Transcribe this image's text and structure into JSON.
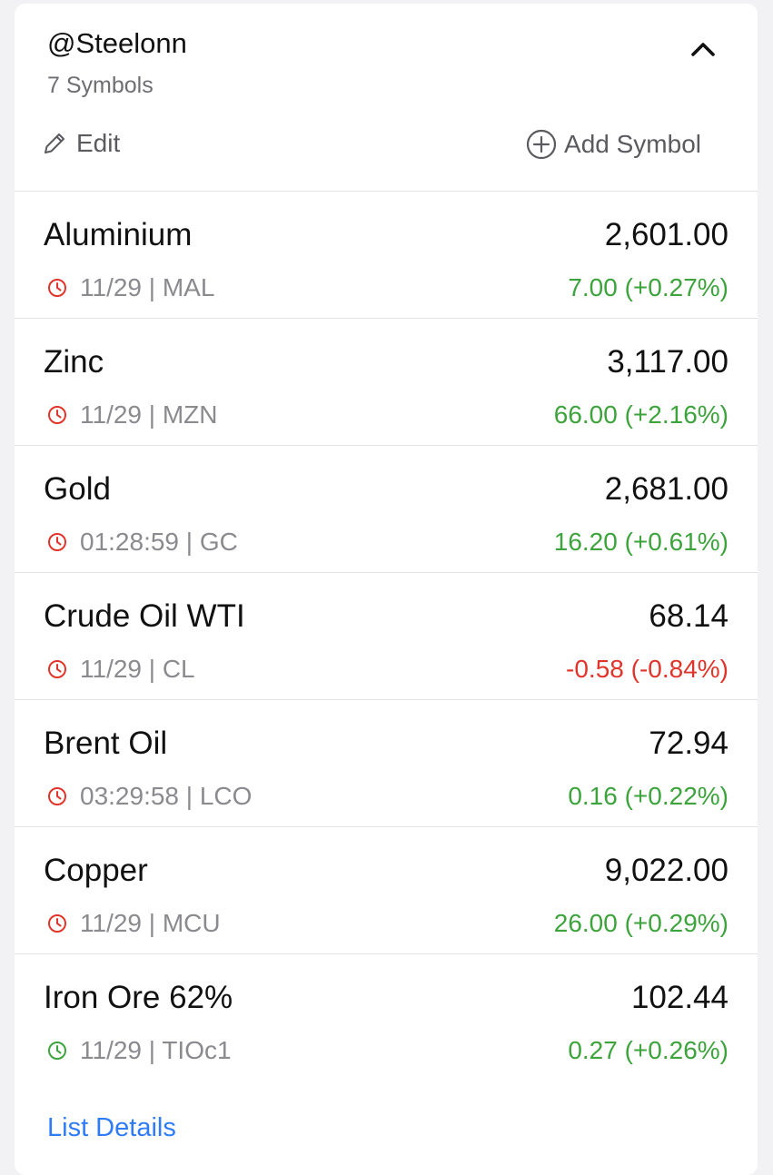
{
  "watchlist": {
    "title": "@Steelonn",
    "subtitle": "7 Symbols",
    "edit_label": "Edit",
    "add_label": "Add Symbol",
    "footer_link": "List Details"
  },
  "colors": {
    "up": "#3da33c",
    "down": "#e0352b",
    "clock_closed": "#e0352b",
    "clock_open": "#3da33c",
    "link": "#2f7cf6"
  },
  "symbols": [
    {
      "name": "Aluminium",
      "price": "2,601.00",
      "meta": "11/29 | MAL",
      "change": "7.00 (+0.27%)",
      "direction": "up",
      "clock": "closed"
    },
    {
      "name": "Zinc",
      "price": "3,117.00",
      "meta": "11/29 | MZN",
      "change": "66.00 (+2.16%)",
      "direction": "up",
      "clock": "closed"
    },
    {
      "name": "Gold",
      "price": "2,681.00",
      "meta": "01:28:59 | GC",
      "change": "16.20 (+0.61%)",
      "direction": "up",
      "clock": "closed"
    },
    {
      "name": "Crude Oil WTI",
      "price": "68.14",
      "meta": "11/29 | CL",
      "change": "-0.58 (-0.84%)",
      "direction": "down",
      "clock": "closed"
    },
    {
      "name": "Brent Oil",
      "price": "72.94",
      "meta": "03:29:58 | LCO",
      "change": "0.16 (+0.22%)",
      "direction": "up",
      "clock": "closed"
    },
    {
      "name": "Copper",
      "price": "9,022.00",
      "meta": "11/29 | MCU",
      "change": "26.00 (+0.29%)",
      "direction": "up",
      "clock": "closed"
    },
    {
      "name": "Iron Ore 62%",
      "price": "102.44",
      "meta": "11/29 | TIOc1",
      "change": "0.27 (+0.26%)",
      "direction": "up",
      "clock": "open"
    }
  ]
}
